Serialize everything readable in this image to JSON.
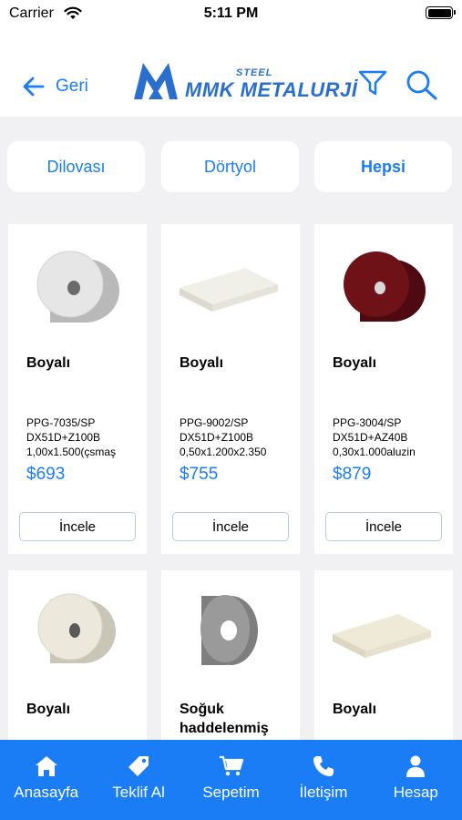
{
  "status": {
    "carrier": "Carrier",
    "time": "5:11 PM"
  },
  "header": {
    "back_label": "Geri",
    "logo_steel": "STEEL",
    "logo_name": "MMK METALURJİ",
    "icons": [
      "arrow-left-icon",
      "funnel-icon",
      "search-icon"
    ]
  },
  "filters": [
    {
      "label": "Dilovası",
      "active": false
    },
    {
      "label": "Dörtyol",
      "active": false
    },
    {
      "label": "Hepsi",
      "active": true
    }
  ],
  "products": [
    {
      "title": "Boyalı",
      "desc": "PPG-7035/SP\nDX51D+Z100B\n1,00x1.500(çsmaş",
      "price": "$693",
      "button": "İncele",
      "image": "white-coil",
      "color": "#e6e6e6"
    },
    {
      "title": "Boyalı",
      "desc": "PPG-9002/SP\nDX51D+Z100B\n0,50x1.200x2.350",
      "price": "$755",
      "button": "İncele",
      "image": "sheet",
      "color": "#f1f0e8"
    },
    {
      "title": "Boyalı",
      "desc": "PPG-3004/SP\nDX51D+AZ40B\n0,30x1.000aluzin",
      "price": "$879",
      "button": "İncele",
      "image": "red-coil",
      "color": "#6e1218"
    },
    {
      "title": "Boyalı",
      "image": "cream-coil",
      "color": "#ece9dc"
    },
    {
      "title": "Soğuk haddelenmiş (…",
      "image": "grey-coil",
      "color": "#9a9a9a"
    },
    {
      "title": "Boyalı",
      "image": "cream-sheet",
      "color": "#efe9d8"
    }
  ],
  "tabs": [
    {
      "label": "Anasayfa",
      "icon": "home-icon"
    },
    {
      "label": "Teklif Al",
      "icon": "tag-icon"
    },
    {
      "label": "Sepetim",
      "icon": "cart-icon"
    },
    {
      "label": "İletişim",
      "icon": "phone-icon"
    },
    {
      "label": "Hesap",
      "icon": "person-icon"
    }
  ]
}
